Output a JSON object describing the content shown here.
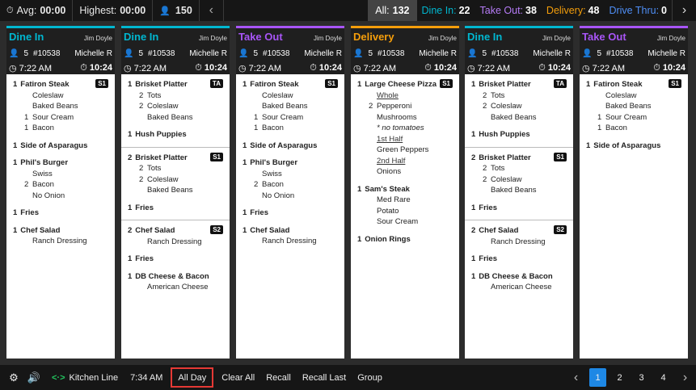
{
  "colors": {
    "dine_in": "#00b7d0",
    "take_out": "#a855f7",
    "delivery": "#f59e0b",
    "drive_thru": "#3b82f6"
  },
  "topbar": {
    "avg_label": "Avg:",
    "avg_value": "00:00",
    "highest_label": "Highest:",
    "highest_value": "00:00",
    "guests": "150",
    "all_label": "All:",
    "all_count": "132",
    "filters": [
      {
        "label": "Dine In:",
        "count": "22"
      },
      {
        "label": "Take Out:",
        "count": "38"
      },
      {
        "label": "Delivery:",
        "count": "48"
      },
      {
        "label": "Drive Thru:",
        "count": "0"
      }
    ]
  },
  "tickets": [
    {
      "type": "Dine In",
      "server": "Jim Doyle",
      "guests": "5",
      "order": "#10538",
      "cashier": "Michelle R",
      "time": "7:22 AM",
      "elapsed": "10:24",
      "groups": [
        [
          {
            "qty": "1",
            "name": "Fatiron Steak",
            "badge": "S1",
            "mods": [
              {
                "q": "",
                "t": "Coleslaw"
              },
              {
                "q": "",
                "t": "Baked Beans"
              },
              {
                "q": "1",
                "t": "Sour Cream"
              },
              {
                "q": "1",
                "t": "Bacon"
              }
            ]
          },
          {
            "qty": "1",
            "name": "Side of Asparagus",
            "badge": "",
            "mods": []
          },
          {
            "qty": "1",
            "name": "Phil's Burger",
            "badge": "",
            "mods": [
              {
                "q": "",
                "t": "Swiss"
              },
              {
                "q": "2",
                "t": "Bacon"
              },
              {
                "q": "",
                "t": "No Onion"
              }
            ]
          },
          {
            "qty": "1",
            "name": "Fries",
            "badge": "",
            "mods": []
          },
          {
            "qty": "1",
            "name": "Chef Salad",
            "badge": "",
            "mods": [
              {
                "q": "",
                "t": "Ranch Dressing"
              }
            ]
          }
        ]
      ]
    },
    {
      "type": "Dine In",
      "server": "Jim Doyle",
      "guests": "5",
      "order": "#10538",
      "cashier": "Michelle R",
      "time": "7:22 AM",
      "elapsed": "10:24",
      "groups": [
        [
          {
            "qty": "1",
            "name": "Brisket Platter",
            "badge": "TA",
            "mods": [
              {
                "q": "2",
                "t": "Tots"
              },
              {
                "q": "2",
                "t": "Coleslaw"
              },
              {
                "q": "",
                "t": "Baked Beans"
              }
            ]
          },
          {
            "qty": "1",
            "name": "Hush Puppies",
            "badge": "",
            "mods": []
          }
        ],
        [
          {
            "qty": "2",
            "name": "Brisket Platter",
            "badge": "S1",
            "mods": [
              {
                "q": "2",
                "t": "Tots"
              },
              {
                "q": "2",
                "t": "Coleslaw"
              },
              {
                "q": "",
                "t": "Baked Beans"
              }
            ]
          },
          {
            "qty": "1",
            "name": "Fries",
            "badge": "",
            "mods": []
          }
        ],
        [
          {
            "qty": "2",
            "name": "Chef Salad",
            "badge": "S2",
            "mods": [
              {
                "q": "",
                "t": "Ranch Dressing"
              }
            ]
          },
          {
            "qty": "1",
            "name": "Fries",
            "badge": "",
            "mods": []
          },
          {
            "qty": "1",
            "name": "DB Cheese & Bacon",
            "badge": "",
            "mods": [
              {
                "q": "",
                "t": "American Cheese"
              }
            ]
          }
        ]
      ]
    },
    {
      "type": "Take Out",
      "server": "Jim Doyle",
      "guests": "5",
      "order": "#10538",
      "cashier": "Michelle R",
      "time": "7:22 AM",
      "elapsed": "10:24",
      "groups": [
        [
          {
            "qty": "1",
            "name": "Fatiron Steak",
            "badge": "S1",
            "mods": [
              {
                "q": "",
                "t": "Coleslaw"
              },
              {
                "q": "",
                "t": "Baked Beans"
              },
              {
                "q": "1",
                "t": "Sour Cream"
              },
              {
                "q": "1",
                "t": "Bacon"
              }
            ]
          },
          {
            "qty": "1",
            "name": "Side of Asparagus",
            "badge": "",
            "mods": []
          },
          {
            "qty": "1",
            "name": "Phil's Burger",
            "badge": "",
            "mods": [
              {
                "q": "",
                "t": "Swiss"
              },
              {
                "q": "2",
                "t": "Bacon"
              },
              {
                "q": "",
                "t": "No Onion"
              }
            ]
          },
          {
            "qty": "1",
            "name": "Fries",
            "badge": "",
            "mods": []
          },
          {
            "qty": "1",
            "name": "Chef Salad",
            "badge": "",
            "mods": [
              {
                "q": "",
                "t": "Ranch Dressing"
              }
            ]
          }
        ]
      ]
    },
    {
      "type": "Delivery",
      "server": "Jim Doyle",
      "guests": "5",
      "order": "#10538",
      "cashier": "Michelle R",
      "time": "7:22 AM",
      "elapsed": "10:24",
      "groups": [
        [
          {
            "qty": "1",
            "name": "Large Cheese Pizza",
            "badge": "S1",
            "mods": [
              {
                "q": "",
                "t": "Whole",
                "sub": true
              },
              {
                "q": "2",
                "t": "Pepperoni"
              },
              {
                "q": "",
                "t": "Mushrooms"
              },
              {
                "q": "",
                "t": "* no tomatoes",
                "note": true
              },
              {
                "q": "",
                "t": "1st Half",
                "sub": true
              },
              {
                "q": "",
                "t": "Green Peppers"
              },
              {
                "q": "",
                "t": "2nd Half",
                "sub": true
              },
              {
                "q": "",
                "t": "Onions"
              }
            ]
          },
          {
            "qty": "1",
            "name": "Sam's Steak",
            "badge": "",
            "mods": [
              {
                "q": "",
                "t": "Med Rare"
              },
              {
                "q": "",
                "t": "Potato"
              },
              {
                "q": "",
                "t": "Sour Cream"
              }
            ]
          },
          {
            "qty": "1",
            "name": "Onion Rings",
            "badge": "",
            "mods": []
          }
        ]
      ]
    },
    {
      "type": "Dine In",
      "server": "Jim Doyle",
      "guests": "5",
      "order": "#10538",
      "cashier": "Michelle R",
      "time": "7:22 AM",
      "elapsed": "10:24",
      "groups": [
        [
          {
            "qty": "1",
            "name": "Brisket Platter",
            "badge": "TA",
            "mods": [
              {
                "q": "2",
                "t": "Tots"
              },
              {
                "q": "2",
                "t": "Coleslaw"
              },
              {
                "q": "",
                "t": "Baked Beans"
              }
            ]
          },
          {
            "qty": "1",
            "name": "Hush Puppies",
            "badge": "",
            "mods": []
          }
        ],
        [
          {
            "qty": "2",
            "name": "Brisket Platter",
            "badge": "S1",
            "mods": [
              {
                "q": "2",
                "t": "Tots"
              },
              {
                "q": "2",
                "t": "Coleslaw"
              },
              {
                "q": "",
                "t": "Baked Beans"
              }
            ]
          },
          {
            "qty": "1",
            "name": "Fries",
            "badge": "",
            "mods": []
          }
        ],
        [
          {
            "qty": "2",
            "name": "Chef Salad",
            "badge": "S2",
            "mods": [
              {
                "q": "",
                "t": "Ranch Dressing"
              }
            ]
          },
          {
            "qty": "1",
            "name": "Fries",
            "badge": "",
            "mods": []
          },
          {
            "qty": "1",
            "name": "DB Cheese & Bacon",
            "badge": "",
            "mods": [
              {
                "q": "",
                "t": "American Cheese"
              }
            ]
          }
        ]
      ]
    },
    {
      "type": "Take Out",
      "server": "Jim Doyle",
      "guests": "5",
      "order": "#10538",
      "cashier": "Michelle R",
      "time": "7:22 AM",
      "elapsed": "10:24",
      "groups": [
        [
          {
            "qty": "1",
            "name": "Fatiron Steak",
            "badge": "S1",
            "mods": [
              {
                "q": "",
                "t": "Coleslaw"
              },
              {
                "q": "",
                "t": "Baked Beans"
              },
              {
                "q": "1",
                "t": "Sour Cream"
              },
              {
                "q": "1",
                "t": "Bacon"
              }
            ]
          },
          {
            "qty": "1",
            "name": "Side of Asparagus",
            "badge": "",
            "mods": []
          }
        ]
      ]
    }
  ],
  "bottombar": {
    "station_label": "Kitchen Line",
    "station_icon_text": "<·>",
    "clock": "7:34 AM",
    "buttons": [
      "All Day",
      "Clear All",
      "Recall",
      "Recall Last",
      "Group"
    ],
    "selected_button": "All Day",
    "pages": [
      "1",
      "2",
      "3",
      "4"
    ],
    "current_page": "1"
  },
  "icons": {
    "timer": "timer-icon",
    "person": "person-icon",
    "clock": "clock-icon",
    "settings": "gear-icon",
    "volume": "speaker-icon",
    "prev": "chevron-left-icon",
    "next": "chevron-right-icon"
  }
}
